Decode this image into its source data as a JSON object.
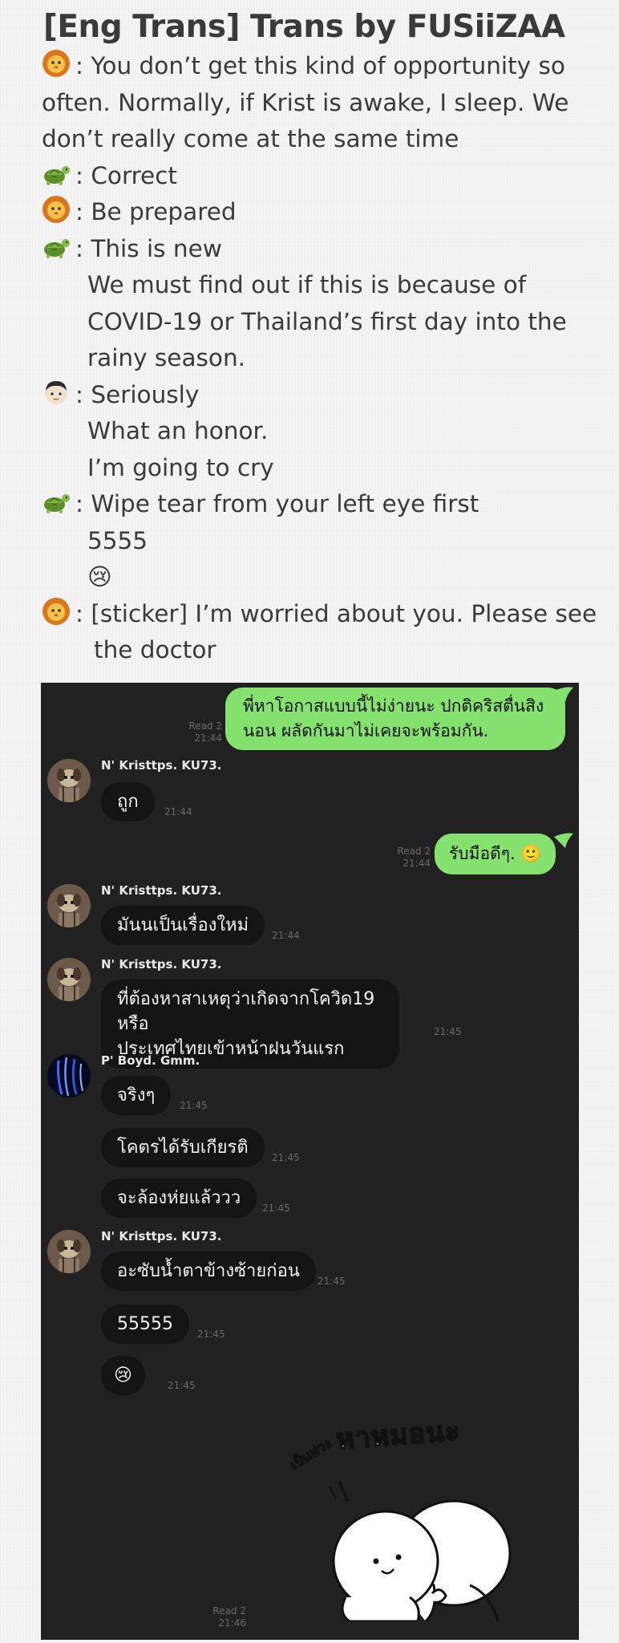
{
  "header": {
    "title": "[Eng Trans] Trans by FUSiiZAA"
  },
  "translation": [
    {
      "speaker_icon": "lion-emoji-icon",
      "text": ": You don’t get this kind of opportunity so"
    },
    {
      "speaker_icon": "",
      "text": "often. Normally, if Krist is awake, I sleep. We"
    },
    {
      "speaker_icon": "",
      "text": "don’t really come at the same time"
    },
    {
      "speaker_icon": "turtle-emoji-icon",
      "text": ": Correct"
    },
    {
      "speaker_icon": "lion-emoji-icon",
      "text": ": Be prepared"
    },
    {
      "speaker_icon": "turtle-emoji-icon",
      "text": ": This is new"
    },
    {
      "speaker_icon": "",
      "text": "We must find out if this is because of"
    },
    {
      "speaker_icon": "",
      "text": "COVID-19 or Thailand’s first day into the"
    },
    {
      "speaker_icon": "",
      "text": "rainy season."
    },
    {
      "speaker_icon": "person-emoji-icon",
      "text": ": Seriously"
    },
    {
      "speaker_icon": "",
      "text": "What an honor."
    },
    {
      "speaker_icon": "",
      "text": "I’m going to cry"
    },
    {
      "speaker_icon": "turtle-emoji-icon",
      "text": ": Wipe tear from your left eye first"
    },
    {
      "speaker_icon": "",
      "text": "5555"
    },
    {
      "speaker_icon": "",
      "text": "😢"
    },
    {
      "speaker_icon": "lion-emoji-icon",
      "text": ": [sticker] I’m worried about you. Please see"
    },
    {
      "speaker_icon": "",
      "text": "the doctor"
    }
  ],
  "chat": {
    "msg1": {
      "line1": "พี่หาโอกาสแบบนี้ไม่ง่ายนะ ปกติคริสตื่นสิง",
      "line2": "นอน ผลัดกันมาไม่เคยจะพร้อมกัน.",
      "read": "Read 2",
      "time": "21:44"
    },
    "krist_name": "N' Kristtps. KU73.",
    "msg2": {
      "text": "ถูก",
      "time": "21:44"
    },
    "msg3": {
      "text": "รับมือดีๆ. 🙂",
      "read": "Read 2",
      "time": "21:44"
    },
    "msg4": {
      "text": "มันนเป็นเรื่องใหม่",
      "time": "21:44"
    },
    "msg5": {
      "line1": "ที่ต้องหาสาเหตุว่าเกิดจากโควิด19 หรือ",
      "line2": "ประเทศไทยเข้าหน้าฝนวันแรก",
      "time": "21:45"
    },
    "boyd_name": "P' Boyd. Gmm.",
    "msg6": {
      "text": "จริงๆ",
      "time": "21:45"
    },
    "msg7": {
      "text": "โคตรได้รับเกียรติ",
      "time": "21:45"
    },
    "msg8": {
      "text": "จะล้องห่ยแล้ววว",
      "time": "21:45"
    },
    "msg9": {
      "text": "อะซับน้ำตาข้างซ้ายก่อน",
      "time": "21:45"
    },
    "msg10": {
      "text": "55555",
      "time": "21:45"
    },
    "msg11": {
      "text": "😢",
      "time": "21:45"
    },
    "sticker": {
      "text_big": "หาหมอนะ",
      "text_small": "เป็นห่วง",
      "read": "Read 2",
      "time": "21:46"
    }
  },
  "colors": {
    "green_bubble": "#86e26e",
    "chat_bg": "#212121",
    "dark_bubble": "#141414"
  }
}
